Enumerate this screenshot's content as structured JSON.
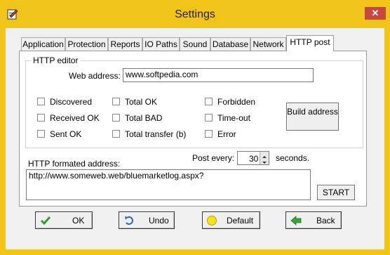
{
  "window": {
    "title": "Settings",
    "accent_color": "#f0c419"
  },
  "tabs": [
    {
      "label": "Application"
    },
    {
      "label": "Protection"
    },
    {
      "label": "Reports"
    },
    {
      "label": "IO Paths"
    },
    {
      "label": "Sound"
    },
    {
      "label": "Database"
    },
    {
      "label": "Network"
    },
    {
      "label": "HTTP post"
    }
  ],
  "active_tab": "HTTP post",
  "http_editor": {
    "group_label": "HTTP editor",
    "web_address_label": "Web address:",
    "web_address_value": "www.softpedia.com",
    "checkboxes": [
      {
        "label": "Discovered",
        "checked": false
      },
      {
        "label": "Received OK",
        "checked": false
      },
      {
        "label": "Sent OK",
        "checked": false
      },
      {
        "label": "Total OK",
        "checked": false
      },
      {
        "label": "Total BAD",
        "checked": false
      },
      {
        "label": "Total transfer (b)",
        "checked": false
      },
      {
        "label": "Forbidden",
        "checked": false
      },
      {
        "label": "Time-out",
        "checked": false
      },
      {
        "label": "Error",
        "checked": false
      }
    ],
    "build_button_label": "Build address"
  },
  "formatted": {
    "label": "HTTP formated address:",
    "value": "http://www.someweb.web/bluemarketlog.aspx?",
    "post_every_label": "Post every:",
    "post_every_value": "30",
    "seconds_label": "seconds.",
    "start_label": "START"
  },
  "bottom_buttons": {
    "ok": "OK",
    "undo": "Undo",
    "default": "Default",
    "back": "Back"
  }
}
